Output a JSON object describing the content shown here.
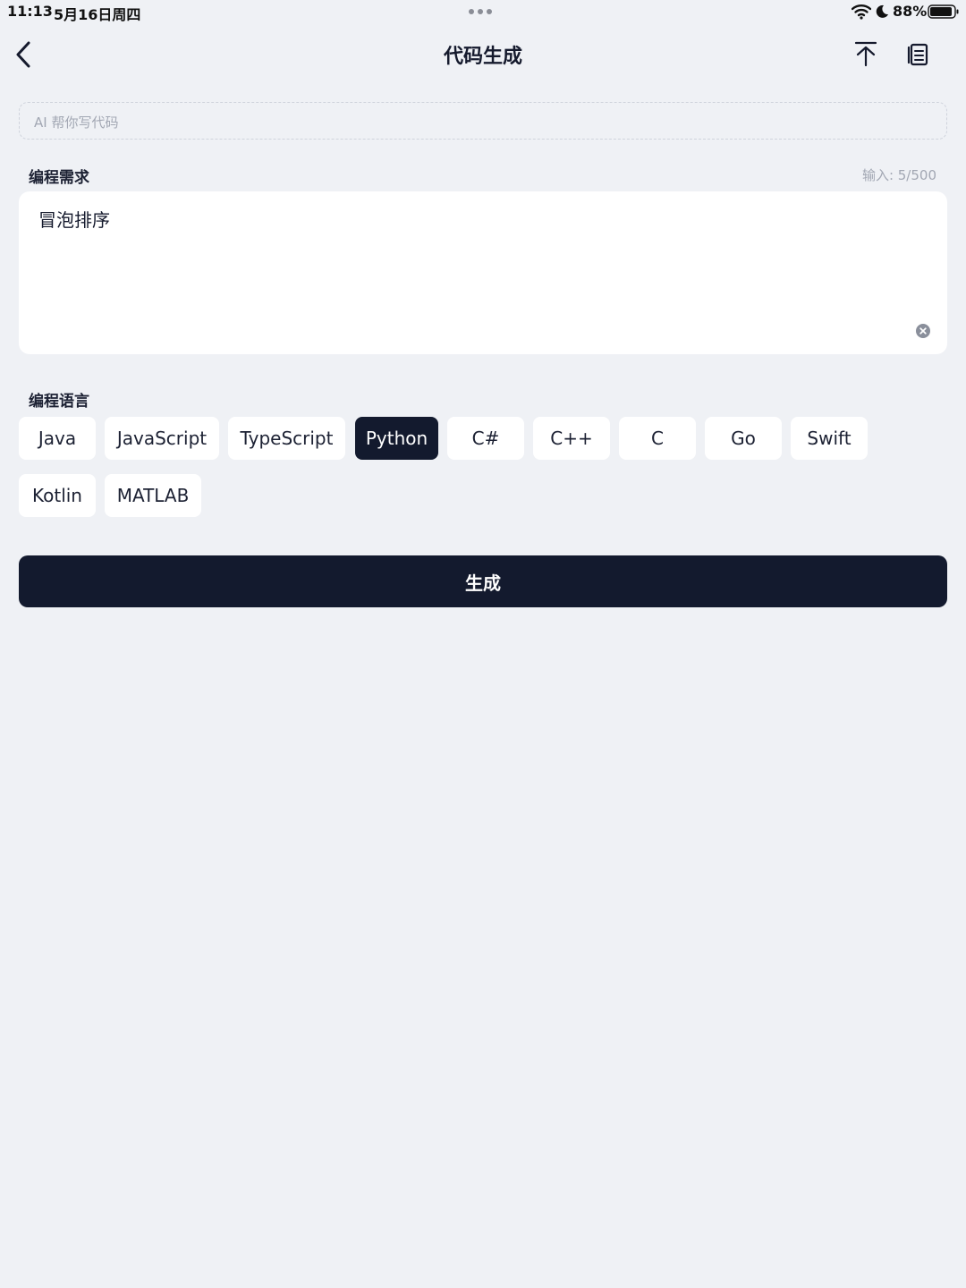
{
  "status_bar": {
    "time": "11:13",
    "date": "5月16日周四",
    "battery": "88%",
    "icons": [
      "more-dots-icon",
      "wifi-icon",
      "moon-icon",
      "battery-icon"
    ]
  },
  "nav": {
    "title": "代码生成",
    "icons": [
      "back-chevron-icon",
      "scroll-top-icon",
      "copy-icon"
    ]
  },
  "ai_banner": {
    "text": "AI 帮你写代码"
  },
  "requirement": {
    "label": "编程需求",
    "count": "输入: 5/500",
    "value": "冒泡排序",
    "clear_icon": "clear-circle-icon"
  },
  "languages": {
    "label": "编程语言",
    "options": [
      "Java",
      "JavaScript",
      "TypeScript",
      "Python",
      "C#",
      "C++",
      "C",
      "Go",
      "Swift",
      "Kotlin",
      "MATLAB"
    ],
    "selected": "Python"
  },
  "generate": {
    "label": "生成"
  },
  "colors": {
    "background": "#eff1f5",
    "card": "#ffffff",
    "primary": "#131a2e",
    "muted_text": "#a2a7b3"
  }
}
